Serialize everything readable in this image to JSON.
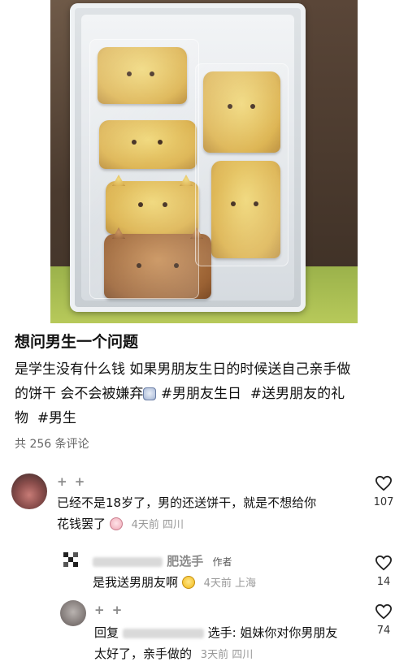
{
  "post": {
    "title": "想问男生一个问题",
    "body_line1": "是学生没有什么钱 如果男朋友生日的时候送自己亲手做",
    "body_line2_pre": "的饼干 会不会被嫌弃",
    "tag1": "#男朋友生日",
    "tag2": "#送男朋友的礼",
    "tag2_cont": "物",
    "tag3": "#男生",
    "comment_count": "共 256 条评论"
  },
  "comments": [
    {
      "name": "+ +",
      "text_line1": "已经不是18岁了，男的还送饼干，就是不想给你",
      "text_line2": "花钱罢了",
      "time": "4天前",
      "location": "四川",
      "likes": "107",
      "emoji": "pig-face-emoji"
    },
    {
      "name_suffix": "肥选手",
      "badge": "作者",
      "text": "是我送男朋友啊",
      "time": "4天前",
      "location": "上海",
      "likes": "14",
      "emoji": "thinking-face-emoji"
    },
    {
      "name": "+ +",
      "reply_prefix": "回复",
      "reply_to_suffix": "选手:",
      "text_line1": "姐妹你对你男朋友",
      "text_line2": "太好了，亲手做的",
      "time": "3天前",
      "location": "四川",
      "likes": "74"
    }
  ],
  "icons": {
    "like": "heart-outline-icon",
    "post_emoji": "shy-face-emoji"
  },
  "colors": {
    "text": "#111111",
    "meta": "#999999",
    "name": "#8a8a8a"
  }
}
